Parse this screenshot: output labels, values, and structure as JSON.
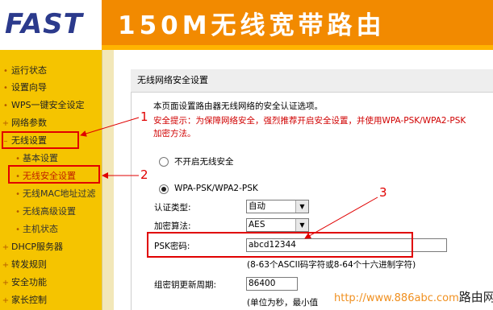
{
  "header": {
    "logo": "FAST",
    "title": "150M无线宽带路由"
  },
  "sidebar": {
    "items": [
      {
        "label": "运行状态"
      },
      {
        "label": "设置向导"
      },
      {
        "label": "WPS一键安全设定"
      },
      {
        "label": "网络参数"
      },
      {
        "label": "无线设置"
      },
      {
        "label": "基本设置"
      },
      {
        "label": "无线安全设置"
      },
      {
        "label": "无线MAC地址过滤"
      },
      {
        "label": "无线高级设置"
      },
      {
        "label": "主机状态"
      },
      {
        "label": "DHCP服务器"
      },
      {
        "label": "转发规则"
      },
      {
        "label": "安全功能"
      },
      {
        "label": "家长控制"
      }
    ]
  },
  "panel": {
    "title": "无线网络安全设置",
    "intro": "本页面设置路由器无线网络的安全认证选项。",
    "warning_line1": "安全提示：为保障网络安全，强烈推荐开启安全设置，并使用WPA-PSK/WPA2-PSK",
    "warning_line2": "加密方法。",
    "option_disable": "不开启无线安全",
    "option_wpa": "WPA-PSK/WPA2-PSK",
    "auth_label": "认证类型:",
    "auth_value": "自动",
    "enc_label": "加密算法:",
    "enc_value": "AES",
    "psk_label": "PSK密码:",
    "psk_value": "abcd12344",
    "psk_hint": "(8-63个ASCII码字符或8-64个十六进制字符)",
    "group_key_label": "组密钥更新周期:",
    "group_key_value": "86400",
    "group_key_hint": "(单位为秒，最小值"
  },
  "annotations": {
    "n1": "1",
    "n2": "2",
    "n3": "3"
  },
  "watermark": {
    "url": "http://www.886abc.com",
    "site": "路由网"
  },
  "colors": {
    "banner": "#f28a00",
    "sidebar": "#f5c400",
    "annotation": "#e00000",
    "logo": "#2b3a8c"
  }
}
